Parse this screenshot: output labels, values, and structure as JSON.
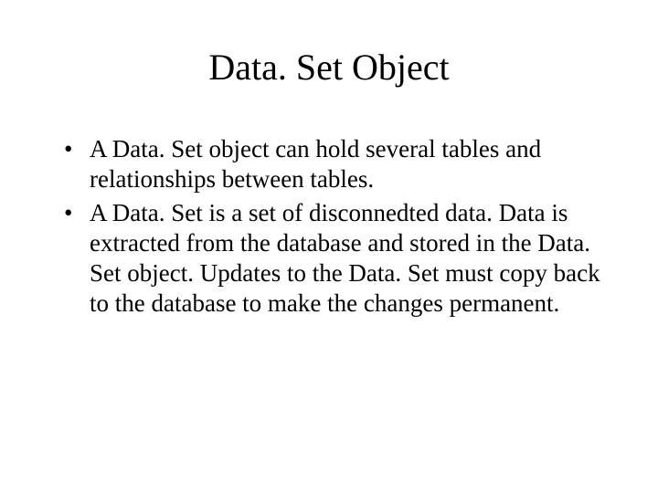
{
  "slide": {
    "title": "Data. Set Object",
    "bullets": [
      "A Data. Set object can hold several tables and relationships between tables.",
      "A Data. Set is a set of disconnedted data.  Data is extracted from the database and stored in the Data. Set object.  Updates to the Data. Set must copy back to the database to make the changes permanent."
    ]
  }
}
